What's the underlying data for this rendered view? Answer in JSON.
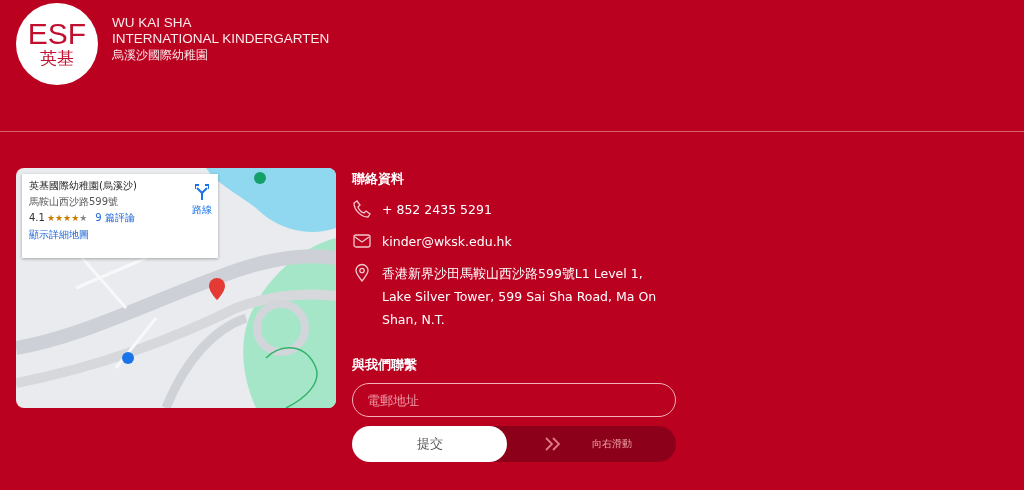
{
  "logo": {
    "mark": "ESF",
    "mark_chinese": "英基",
    "name_lines": [
      "WU KAI SHA",
      "INTERNATIONAL KINDERGARTEN"
    ],
    "name_chinese": "烏溪沙國際幼稚園"
  },
  "map": {
    "kind": "picture",
    "card": {
      "title": "英基國際幼稚園(烏溪沙)",
      "address": "馬鞍山西沙路599號",
      "rating": "4.1",
      "stars": 4,
      "reviews": "9 篇評論",
      "link": "顯示詳細地圖",
      "directions": "路線"
    }
  },
  "contact": {
    "heading": "聯絡資料",
    "items": [
      {
        "kind": "phone",
        "text": "+ 852 2435 5291"
      },
      {
        "kind": "email",
        "text": "kinder@wksk.edu.hk"
      },
      {
        "kind": "address",
        "text": "香港新界沙田馬鞍山西沙路599號L1 Level 1, Lake Silver Tower, 599 Sai Sha Road, Ma On Shan, N.T."
      }
    ]
  },
  "form": {
    "heading": "與我們聯繫",
    "email_placeholder": "電郵地址",
    "submit": "提交",
    "slide_hint": "向右滑動"
  }
}
